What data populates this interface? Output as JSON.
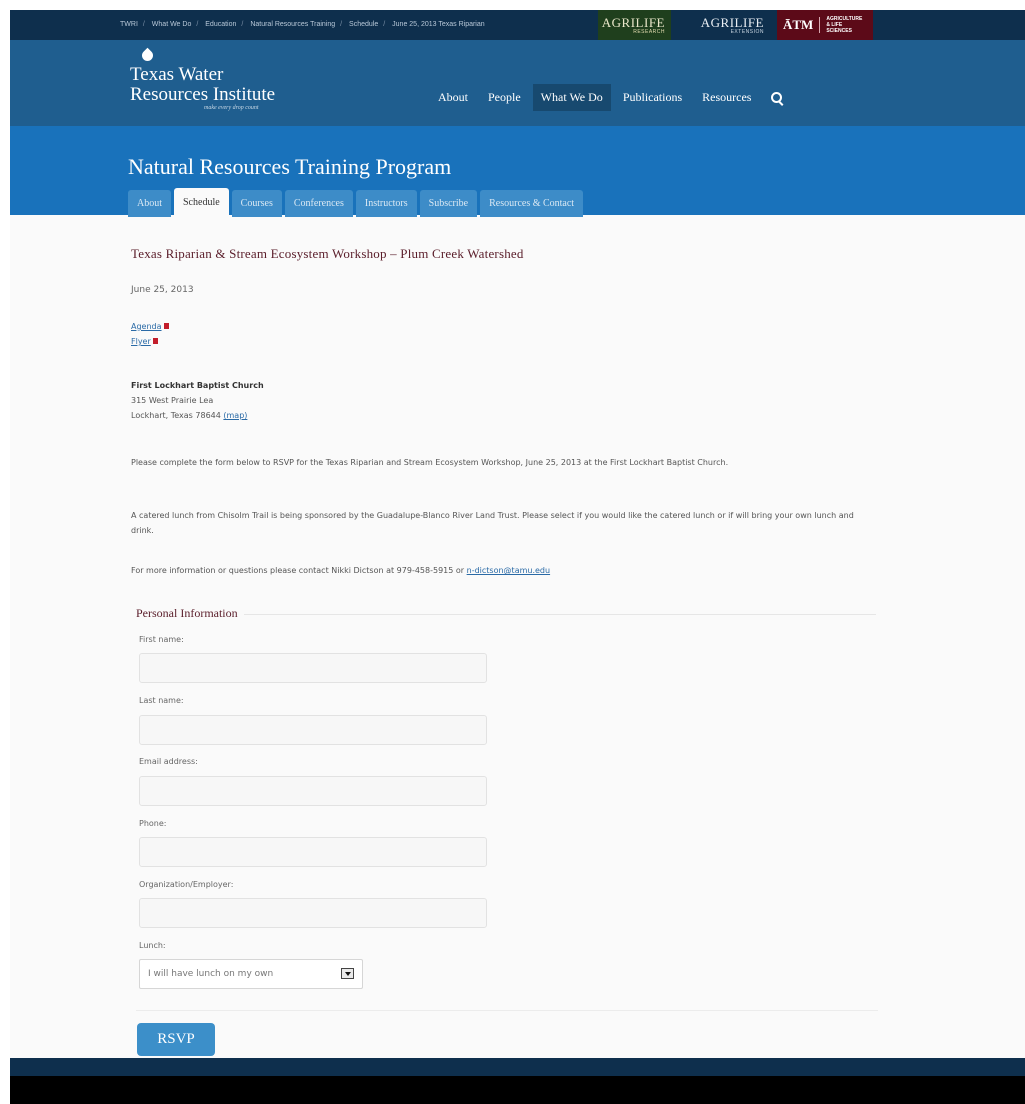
{
  "topbar": {
    "breadcrumbs": [
      "TWRI",
      "What We Do",
      "Education",
      "Natural Resources Training",
      "Schedule",
      "June 25, 2013 Texas Riparian"
    ],
    "logos": {
      "agrilife_research": {
        "main": "AGRILIFE",
        "sub": "RESEARCH"
      },
      "agrilife_extension": {
        "main": "AGRILIFE",
        "sub": "EXTENSION"
      },
      "tamu": {
        "mark": "ĀTM",
        "line1": "AGRICULTURE",
        "line2": "& LIFE SCIENCES"
      }
    }
  },
  "header": {
    "site_name_line1": "Texas Water",
    "site_name_line2": "Resources Institute",
    "tagline": "make every drop count",
    "nav": [
      {
        "label": "About"
      },
      {
        "label": "People"
      },
      {
        "label": "What We Do",
        "active": true
      },
      {
        "label": "Publications"
      },
      {
        "label": "Resources"
      }
    ]
  },
  "program": {
    "title": "Natural Resources Training Program",
    "tabs": [
      {
        "label": "About"
      },
      {
        "label": "Schedule",
        "active": true
      },
      {
        "label": "Courses"
      },
      {
        "label": "Conferences"
      },
      {
        "label": "Instructors"
      },
      {
        "label": "Subscribe"
      },
      {
        "label": "Resources & Contact"
      }
    ]
  },
  "event": {
    "title": "Texas Riparian & Stream Ecosystem Workshop – Plum Creek Watershed",
    "date": "June 25, 2013",
    "links": {
      "agenda": "Agenda",
      "flyer": "Flyer"
    },
    "venue": {
      "name": "First Lockhart Baptist Church",
      "street": "315 West Prairie Lea",
      "city": "Lockhart, Texas 78644",
      "map_link": "(map)"
    },
    "para1": "Please complete the form below to RSVP for the Texas Riparian and Stream Ecosystem Workshop, June 25, 2013 at the First Lockhart Baptist Church.",
    "para2": "A catered lunch from Chisolm Trail is being sponsored by the Guadalupe-Blanco River Land Trust. Please select if you would like the catered lunch or if will bring your own lunch and drink.",
    "para3_prefix": "For more information or questions please contact Nikki Dictson at 979-458-5915 or ",
    "contact_email": "n-dictson@tamu.edu"
  },
  "form": {
    "legend": "Personal Information",
    "first_name_label": "First name:",
    "last_name_label": "Last name:",
    "email_label": "Email address:",
    "phone_label": "Phone:",
    "org_label": "Organization/Employer:",
    "lunch_label": "Lunch:",
    "lunch_selected": "I will have lunch on my own",
    "submit_label": "RSVP"
  }
}
